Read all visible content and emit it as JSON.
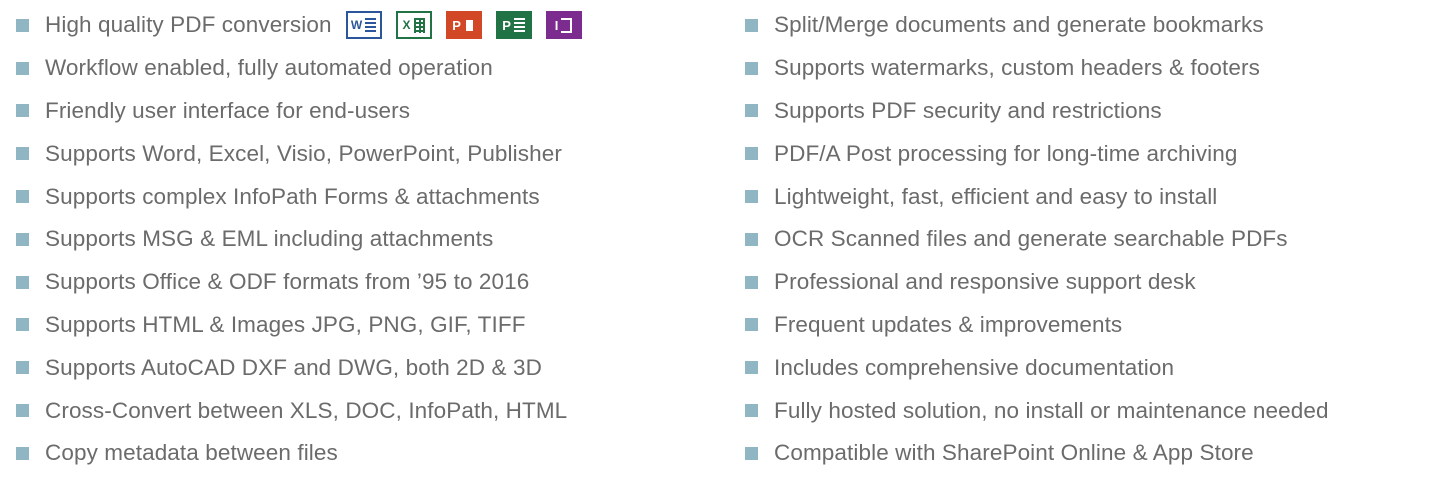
{
  "accent_color": "#8fb6c2",
  "text_color": "#6b6b6b",
  "left_column": [
    "High quality PDF conversion",
    "Workflow enabled, fully automated operation",
    "Friendly user interface for end-users",
    "Supports Word, Excel, Visio, PowerPoint, Publisher",
    "Supports complex InfoPath Forms & attachments",
    "Supports MSG & EML including attachments",
    "Supports Office & ODF formats from ’95 to 2016",
    "Supports HTML & Images JPG, PNG, GIF, TIFF",
    "Supports AutoCAD DXF and DWG, both 2D & 3D",
    "Cross-Convert between XLS, DOC, InfoPath, HTML",
    "Copy metadata between files"
  ],
  "right_column": [
    "Split/Merge documents and generate bookmarks",
    "Supports watermarks, custom headers & footers",
    "Supports PDF security and restrictions",
    "PDF/A Post processing for long-time archiving",
    "Lightweight, fast, efficient and easy to install",
    "OCR Scanned files and generate searchable PDFs",
    "Professional and responsive support desk",
    "Frequent updates & improvements",
    "Includes comprehensive documentation",
    "Fully hosted solution, no install or maintenance needed",
    "Compatible with SharePoint Online & App Store"
  ],
  "app_icons": [
    {
      "name": "word-icon",
      "letter": "W",
      "color": "#2b579a"
    },
    {
      "name": "excel-icon",
      "letter": "X",
      "color": "#217346"
    },
    {
      "name": "powerpoint-icon",
      "letter": "P",
      "color": "#d24726"
    },
    {
      "name": "project-icon",
      "letter": "P",
      "color": "#217346"
    },
    {
      "name": "infopath-icon",
      "letter": "I",
      "color": "#7b2c8e"
    }
  ]
}
